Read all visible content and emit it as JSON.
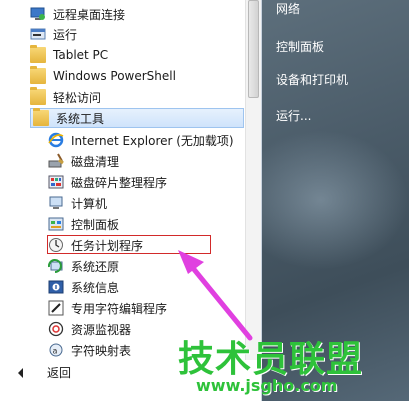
{
  "left_menu": {
    "items": [
      {
        "label": "远程桌面连接",
        "icon": "remote-desktop-icon"
      },
      {
        "label": "运行",
        "icon": "run-icon"
      },
      {
        "label": "Tablet PC",
        "icon": "folder-icon"
      },
      {
        "label": "Windows PowerShell",
        "icon": "folder-icon"
      },
      {
        "label": "轻松访问",
        "icon": "folder-icon"
      },
      {
        "label": "系统工具",
        "icon": "folder-icon"
      },
      {
        "label": "Internet Explorer (无加载项)",
        "icon": "internet-explorer-icon"
      },
      {
        "label": "磁盘清理",
        "icon": "disk-cleanup-icon"
      },
      {
        "label": "磁盘碎片整理程序",
        "icon": "defragmenter-icon"
      },
      {
        "label": "计算机",
        "icon": "computer-icon"
      },
      {
        "label": "控制面板",
        "icon": "control-panel-icon"
      },
      {
        "label": "任务计划程序",
        "icon": "task-scheduler-icon"
      },
      {
        "label": "系统还原",
        "icon": "system-restore-icon"
      },
      {
        "label": "系统信息",
        "icon": "system-info-icon"
      },
      {
        "label": "专用字符编辑程序",
        "icon": "char-editor-icon"
      },
      {
        "label": "资源监视器",
        "icon": "resource-monitor-icon"
      },
      {
        "label": "字符映射表",
        "icon": "char-map-icon"
      }
    ],
    "back_label": "返回"
  },
  "right_panel": {
    "items": [
      "网络",
      "控制面板",
      "设备和打印机",
      "运行..."
    ]
  },
  "watermark": {
    "text": "技术员联盟",
    "url": "www.jsgho.com"
  },
  "colors": {
    "highlight_box": "#d22a2a",
    "arrow": "#e040e0",
    "watermark": "#2ec23a"
  }
}
